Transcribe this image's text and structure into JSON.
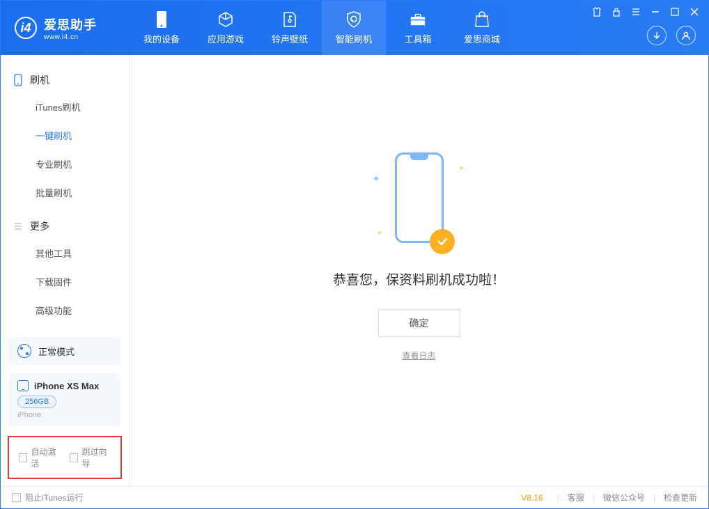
{
  "app": {
    "name": "爱思助手",
    "url": "www.i4.cn"
  },
  "nav": [
    {
      "label": "我的设备"
    },
    {
      "label": "应用游戏"
    },
    {
      "label": "铃声壁纸"
    },
    {
      "label": "智能刷机"
    },
    {
      "label": "工具箱"
    },
    {
      "label": "爱思商城"
    }
  ],
  "sidebar": {
    "group1": {
      "title": "刷机",
      "items": [
        {
          "label": "iTunes刷机"
        },
        {
          "label": "一键刷机"
        },
        {
          "label": "专业刷机"
        },
        {
          "label": "批量刷机"
        }
      ]
    },
    "group2": {
      "title": "更多",
      "items": [
        {
          "label": "其他工具"
        },
        {
          "label": "下载固件"
        },
        {
          "label": "高级功能"
        }
      ]
    },
    "mode": "正常模式",
    "device": {
      "name": "iPhone XS Max",
      "storage": "256GB",
      "type": "iPhone"
    },
    "options": {
      "auto_activate": "自动激活",
      "skip_wizard": "跳过向导"
    }
  },
  "main": {
    "success_message": "恭喜您，保资料刷机成功啦！",
    "ok_button": "确定",
    "view_log": "查看日志"
  },
  "footer": {
    "block_itunes": "阻止iTunes运行",
    "version": "V8.16",
    "support": "客服",
    "wechat": "微信公众号",
    "check_update": "检查更新"
  }
}
